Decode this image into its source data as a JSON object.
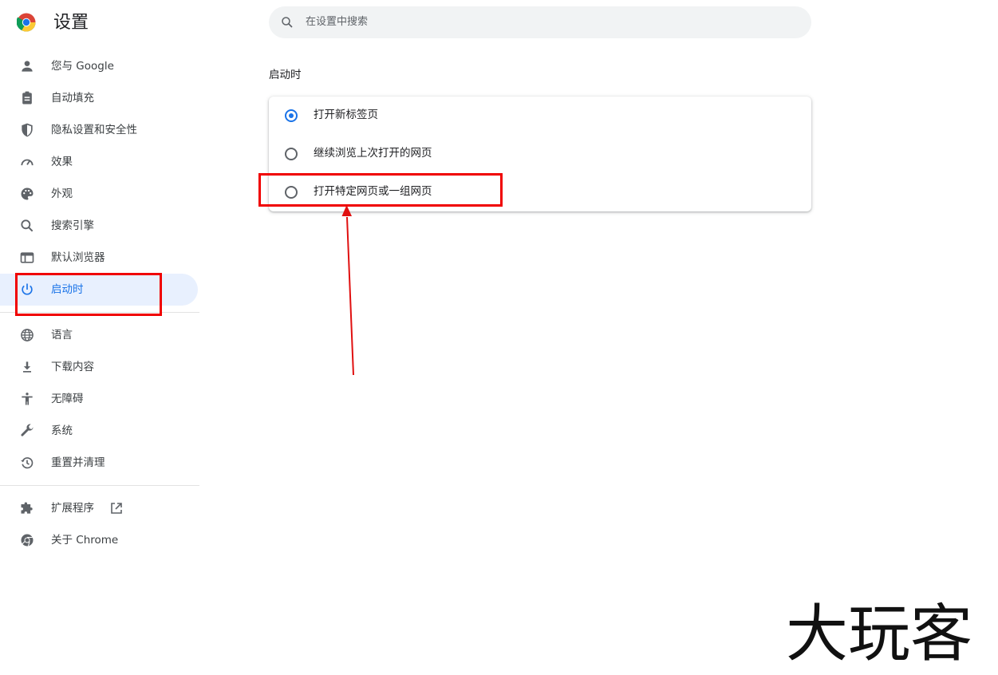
{
  "header": {
    "title": "设置"
  },
  "search": {
    "placeholder": "在设置中搜索"
  },
  "sidebar": {
    "items": [
      {
        "label": "您与 Google",
        "icon": "person-icon"
      },
      {
        "label": "自动填充",
        "icon": "clipboard-icon"
      },
      {
        "label": "隐私设置和安全性",
        "icon": "shield-icon"
      },
      {
        "label": "效果",
        "icon": "speedometer-icon"
      },
      {
        "label": "外观",
        "icon": "palette-icon"
      },
      {
        "label": "搜索引擎",
        "icon": "search-icon"
      },
      {
        "label": "默认浏览器",
        "icon": "browser-window-icon"
      },
      {
        "label": "启动时",
        "icon": "power-icon",
        "active": true
      }
    ],
    "items2": [
      {
        "label": "语言",
        "icon": "globe-icon"
      },
      {
        "label": "下载内容",
        "icon": "download-icon"
      },
      {
        "label": "无障碍",
        "icon": "accessibility-icon"
      },
      {
        "label": "系统",
        "icon": "wrench-icon"
      },
      {
        "label": "重置并清理",
        "icon": "history-icon"
      }
    ],
    "items3": [
      {
        "label": "扩展程序",
        "icon": "puzzle-icon"
      },
      {
        "label": "关于 Chrome",
        "icon": "chrome-icon"
      }
    ]
  },
  "main": {
    "section_title": "启动时",
    "options": [
      {
        "label": "打开新标签页",
        "checked": true
      },
      {
        "label": "继续浏览上次打开的网页",
        "checked": false
      },
      {
        "label": "打开特定网页或一组网页",
        "checked": false
      }
    ]
  },
  "watermark": {
    "text": "大玩客"
  },
  "colors": {
    "accent": "#1a73e8",
    "active_bg": "#e8f0fe",
    "highlight": "#f00000"
  }
}
